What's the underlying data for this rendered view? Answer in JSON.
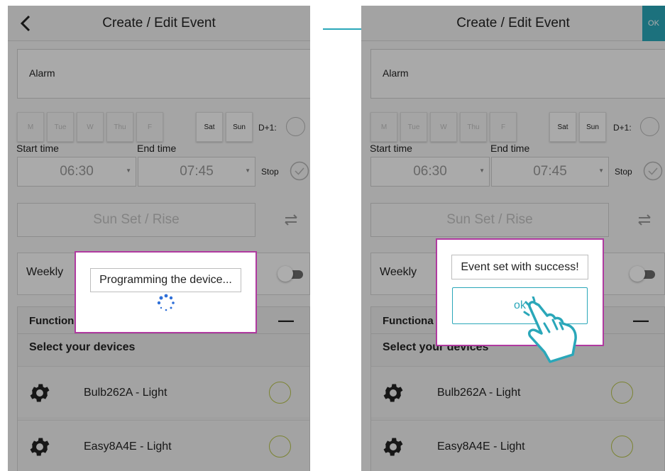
{
  "screens": [
    {
      "title": "Create / Edit Event",
      "event_name": "Alarm",
      "days": [
        {
          "label": "M",
          "active": false
        },
        {
          "label": "Tue",
          "active": false
        },
        {
          "label": "W",
          "active": false
        },
        {
          "label": "Thu",
          "active": false
        },
        {
          "label": "F",
          "active": false
        },
        {
          "label": "Sat",
          "active": true
        },
        {
          "label": "Sun",
          "active": true
        }
      ],
      "d_plus_one_label": "D+1:",
      "start_time_label": "Start time",
      "end_time_label": "End time",
      "start_time": "06:30",
      "end_time": "07:45",
      "stop_label": "Stop",
      "sun_button": "Sun Set / Rise",
      "weekly_label": "Weekly",
      "panel_title": "Function",
      "panel_collapse": "—",
      "select_devices": "Select your devices",
      "devices": [
        {
          "name": "Bulb262A - Light"
        },
        {
          "name": "Easy8A4E - Light"
        }
      ],
      "dialog_message": "Programming the device..."
    },
    {
      "title": "Create / Edit Event",
      "ok_button": "OK",
      "event_name": "Alarm",
      "d_plus_one_label": "D+1:",
      "start_time_label": "Start time",
      "end_time_label": "End time",
      "start_time": "06:30",
      "end_time": "07:45",
      "stop_label": "Stop",
      "sun_button": "Sun Set / Rise",
      "weekly_label": "Weekly",
      "panel_title": "Functiona",
      "panel_collapse": "—",
      "select_devices": "Select your devices",
      "devices": [
        {
          "name": "Bulb262A - Light"
        },
        {
          "name": "Easy8A4E - Light"
        }
      ],
      "dialog_message": "Event set with success!",
      "dialog_ok": "ok"
    }
  ],
  "colors": {
    "accent": "#2aa7b9",
    "dialog_border": "#b03aa0",
    "device_selector": "#b6c24a"
  }
}
